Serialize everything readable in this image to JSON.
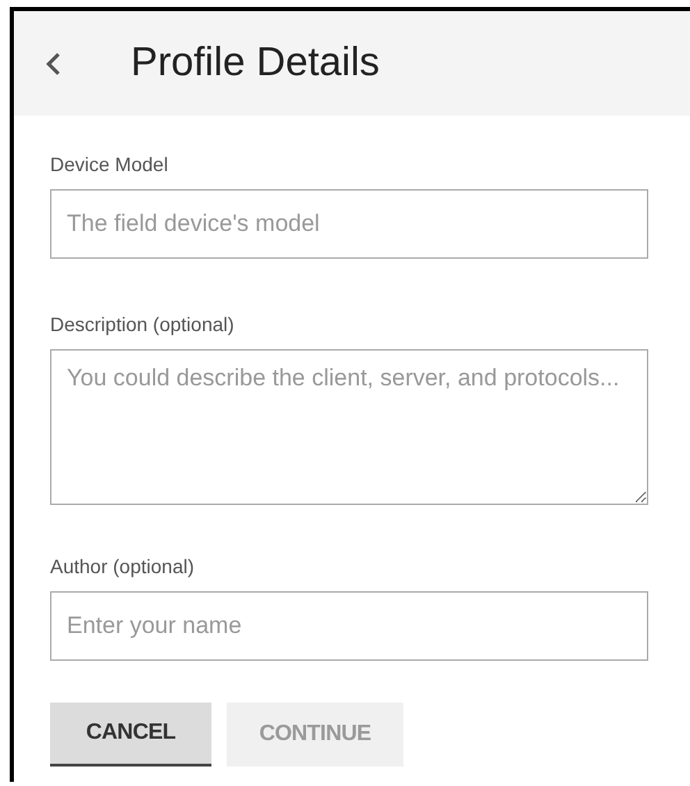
{
  "header": {
    "title": "Profile Details"
  },
  "fields": [
    {
      "kind": "input",
      "label": "Device Model",
      "placeholder": "The field device's model"
    },
    {
      "kind": "textarea",
      "label": "Description (optional)",
      "placeholder": "You could describe the client, server, and protocols..."
    },
    {
      "kind": "input",
      "label": "Author (optional)",
      "placeholder": "Enter your name"
    }
  ],
  "buttons": [
    {
      "label": "CANCEL",
      "disabled": false
    },
    {
      "label": "CONTINUE",
      "disabled": true
    }
  ]
}
